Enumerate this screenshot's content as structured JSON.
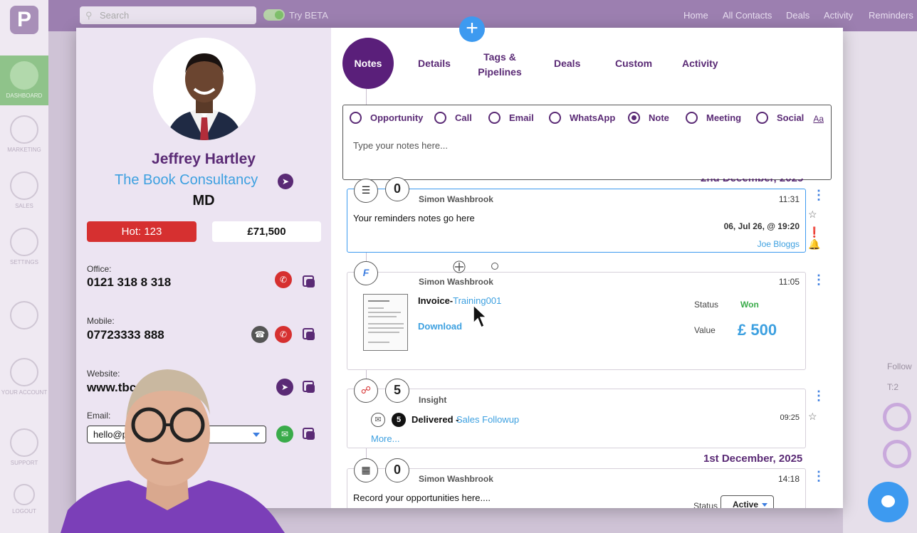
{
  "app": {
    "search_placeholder": "Search",
    "try_beta": "Try BETA",
    "nav": [
      "Home",
      "All Contacts",
      "Deals",
      "Activity",
      "Reminders"
    ],
    "sidebar": [
      "DASHBOARD",
      "MARKETING",
      "SALES",
      "SETTINGS",
      "YOUR ACCOUNT",
      "SUPPORT",
      "LOGOUT"
    ],
    "right_follow": "Follow",
    "right_t": "T:2"
  },
  "contact": {
    "name": "Jeffrey Hartley",
    "company": "The Book Consultancy",
    "role": "MD",
    "hot": "Hot: 123",
    "value": "£71,500",
    "office_label": "Office:",
    "office": "0121 318 8 318",
    "mobile_label": "Mobile:",
    "mobile": "07723333 888",
    "website_label": "Website:",
    "website": "www.tbc",
    "email_label": "Email:",
    "email": "hello@p"
  },
  "tabs": {
    "notes": "Notes",
    "details": "Details",
    "tags_line1": "Tags &",
    "tags_line2": "Pipelines",
    "deals": "Deals",
    "custom": "Custom",
    "activity": "Activity"
  },
  "note_types": [
    {
      "label": "Opportunity",
      "selected": false
    },
    {
      "label": "Call",
      "selected": false
    },
    {
      "label": "Email",
      "selected": false
    },
    {
      "label": "WhatsApp",
      "selected": false
    },
    {
      "label": "Note",
      "selected": true
    },
    {
      "label": "Meeting",
      "selected": false
    },
    {
      "label": "Social",
      "selected": false
    }
  ],
  "note_aa": "Aa",
  "note_placeholder": "Type your notes here...",
  "timeline": {
    "date1": "2nd December, 2025",
    "reminder": {
      "count": "0",
      "author": "Simon Washbrook",
      "time": "11:31",
      "text": "Your reminders notes go here",
      "due": "06, Jul 26, @ 19:20",
      "assignee": "Joe Bloggs"
    },
    "invoice": {
      "author": "Simon Washbrook",
      "time": "11:05",
      "title_prefix": "Invoice-",
      "title_link": "Training001",
      "download": "Download",
      "status_label": "Status",
      "status": "Won",
      "value_label": "Value",
      "value": "£ 500"
    },
    "insight": {
      "count": "5",
      "label": "Insight",
      "sub_count": "5",
      "delivered": "Delivered -",
      "campaign": "Sales Followup",
      "time": "09:25",
      "more": "More..."
    },
    "date2": "1st December, 2025",
    "opportunity": {
      "count": "0",
      "author": "Simon Washbrook",
      "time": "14:18",
      "text": "Record your opportunities here....",
      "status_label": "Status",
      "status": "Active"
    }
  },
  "colors": {
    "brand_purple": "#5a1f7a",
    "accent_blue": "#3d9af0",
    "hot_red": "#d63030",
    "won_green": "#3aab4a"
  }
}
